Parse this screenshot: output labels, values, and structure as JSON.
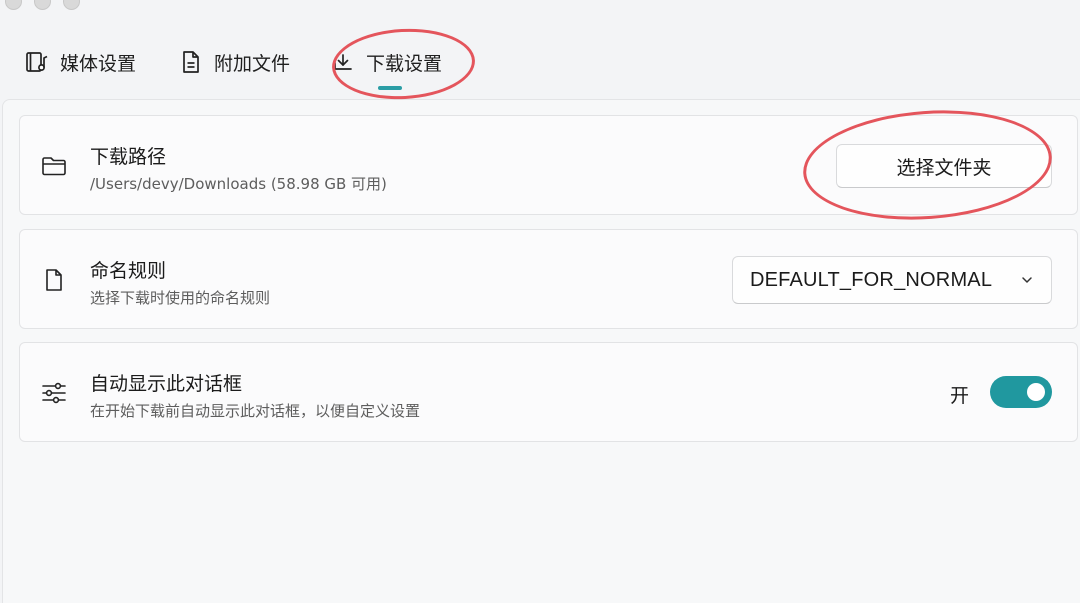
{
  "tabs": [
    {
      "label": "媒体设置",
      "icon": "film-music-icon"
    },
    {
      "label": "附加文件",
      "icon": "document-icon"
    },
    {
      "label": "下载设置",
      "icon": "download-icon",
      "active": true
    }
  ],
  "download_path": {
    "title": "下载路径",
    "path": "/Users/devy/Downloads (58.98 GB 可用)",
    "button_label": "选择文件夹",
    "icon": "folder-icon"
  },
  "naming_rule": {
    "title": "命名规则",
    "subtitle": "选择下载时使用的命名规则",
    "selected": "DEFAULT_FOR_NORMAL",
    "icon": "file-icon"
  },
  "auto_show": {
    "title": "自动显示此对话框",
    "subtitle": "在开始下载前自动显示此对话框，以便自定义设置",
    "toggle_label": "开",
    "enabled": true,
    "icon": "sliders-icon"
  },
  "colors": {
    "accent": "#20989f",
    "annotation": "#e4555c"
  }
}
